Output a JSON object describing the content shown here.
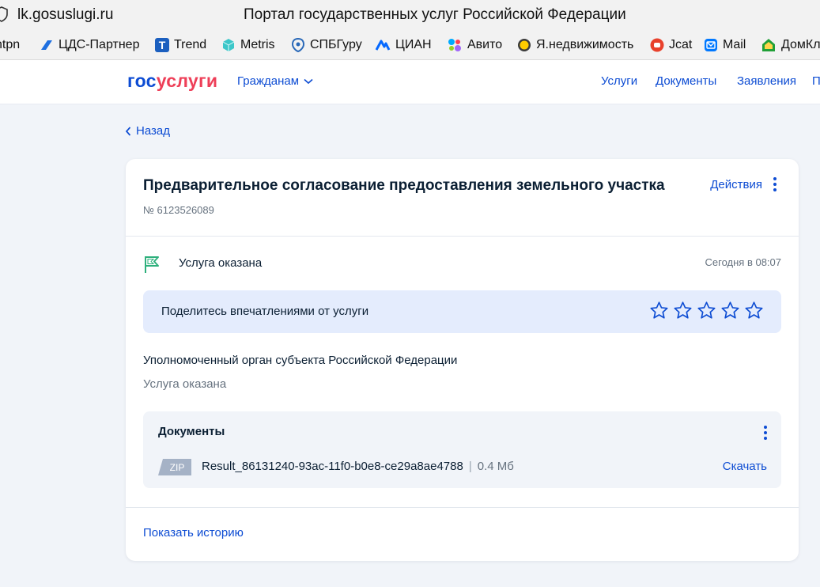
{
  "browser": {
    "url": "lk.gosuslugi.ru",
    "window_title": "Портал государственных услуг Российской Федерации"
  },
  "bookmarks": [
    {
      "label": "ntpn",
      "icon": "none"
    },
    {
      "label": "ЦДС-Партнер",
      "icon": "cds-partner-icon"
    },
    {
      "label": "Trend",
      "icon": "trend-icon"
    },
    {
      "label": "Metris",
      "icon": "metris-icon"
    },
    {
      "label": "СПБГуру",
      "icon": "spbguru-icon"
    },
    {
      "label": "ЦИАН",
      "icon": "cian-icon"
    },
    {
      "label": "Авито",
      "icon": "avito-icon"
    },
    {
      "label": "Я.недвижимость",
      "icon": "yandex-realty-icon"
    },
    {
      "label": "Jcat",
      "icon": "jcat-icon"
    },
    {
      "label": "Mail",
      "icon": "mail-icon"
    },
    {
      "label": "ДомКл",
      "icon": "domclick-icon"
    }
  ],
  "header": {
    "logo_part1": "гос",
    "logo_part2": "услуги",
    "audience": "Гражданам",
    "nav": [
      "Услуги",
      "Документы",
      "Заявления",
      "П"
    ]
  },
  "back_label": "Назад",
  "application": {
    "title": "Предварительное согласование предоставления земельного участка",
    "number": "№ 6123526089",
    "actions_label": "Действия",
    "status_label": "Услуга оказана",
    "status_time": "Сегодня в 08:07",
    "feedback_prompt": "Поделитесь впечатлениями от услуги",
    "rating_max": 5,
    "rating_value": 0,
    "organization": "Уполномоченный орган субъекта Российской Федерации",
    "organization_status": "Услуга оказана",
    "documents": {
      "title": "Документы",
      "file_type": "ZIP",
      "file_name": "Result_86131240-93ac-11f0-b0e8-ce29a8ae4788",
      "separator": "|",
      "file_size": "0.4 Мб",
      "download_label": "Скачать"
    },
    "history_label": "Показать историю"
  },
  "colors": {
    "accent": "#0d4cd3",
    "logo_red": "#ee3f58",
    "success": "#2eb07c",
    "feedback_bg": "#e4ecfd"
  }
}
